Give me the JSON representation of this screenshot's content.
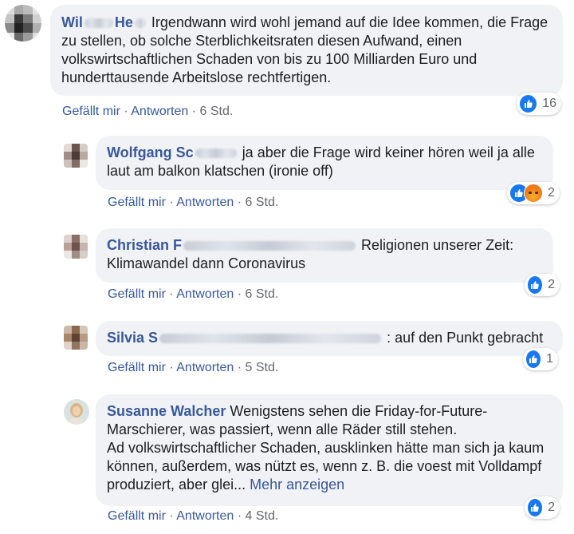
{
  "comments": [
    {
      "name_start": "Wil",
      "name_mid": "",
      "name_end": "He",
      "text": "Irgendwann wird wohl jemand auf die Idee kommen, die Frage zu stellen, ob solche Sterblichkeitsraten diesen Aufwand, einen volkswirtschaftlichen Schaden von bis zu 100 Milliarden Euro und hunderttausende Arbeitslose rechtfertigen.",
      "like": "Gefällt mir",
      "reply": "Antworten",
      "time": "6 Std.",
      "reaction_count": "16",
      "reaction_icons": [
        "like-icon"
      ]
    },
    {
      "name_start": "Wolfgang Sc",
      "text": "ja aber die Frage wird keiner hören weil ja alle laut am balkon klatschen (ironie off)",
      "like": "Gefällt mir",
      "reply": "Antworten",
      "time": "6 Std.",
      "reaction_count": "2",
      "reaction_icons": [
        "like-icon",
        "angry-icon"
      ]
    },
    {
      "name_start": "Christian F",
      "text": "Religionen unserer Zeit: Klimawandel dann Coronavirus",
      "like": "Gefällt mir",
      "reply": "Antworten",
      "time": "6 Std.",
      "reaction_count": "2",
      "reaction_icons": [
        "like-icon"
      ]
    },
    {
      "name_start": "Silvia S",
      "text": ": auf den Punkt gebracht",
      "like": "Gefällt mir",
      "reply": "Antworten",
      "time": "5 Std.",
      "reaction_count": "1",
      "reaction_icons": [
        "like-icon"
      ]
    },
    {
      "name_start": "Susanne Walcher",
      "text": "Wenigstens sehen die Friday-for-Future-Marschierer, was passiert, wenn alle Räder still stehen.",
      "text2": "Ad volkswirtschaftlicher Schaden, ausklinken hätte man sich ja kaum können, außerdem, was nützt es, wenn z. B. die voest mit Volldampf produziert, aber glei...",
      "more": "Mehr anzeigen",
      "like": "Gefällt mir",
      "reply": "Antworten",
      "time": "4 Std.",
      "reaction_count": "2",
      "reaction_icons": [
        "like-icon"
      ]
    }
  ],
  "separator": " · ",
  "colors": {
    "name": "#385898",
    "bubble": "#f0f2f5",
    "meta": "#65676b",
    "like": "#1877f2"
  }
}
